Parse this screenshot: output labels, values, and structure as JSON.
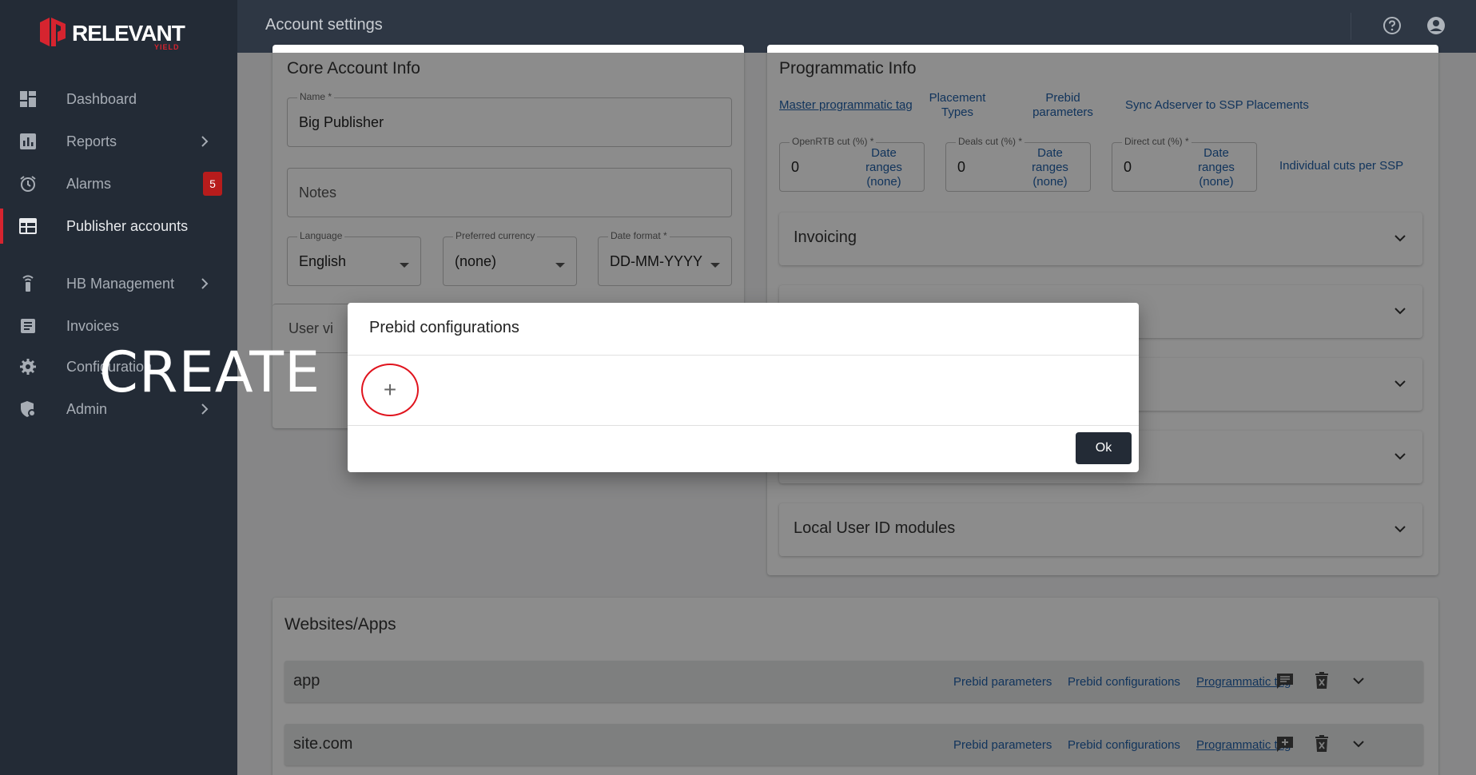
{
  "app": {
    "brand": "RELEVANT",
    "brand_sub": "YIELD",
    "page_title": "Account settings",
    "accent": "#d6242f"
  },
  "sidebar": {
    "items": [
      {
        "label": "Dashboard",
        "icon": "dashboard-icon"
      },
      {
        "label": "Reports",
        "icon": "bar-chart-icon"
      },
      {
        "label": "Alarms",
        "icon": "alarm-clock-icon",
        "badge": "5"
      },
      {
        "label": "Publisher accounts",
        "icon": "table-icon"
      },
      {
        "label": "HB Management",
        "icon": "antenna-icon"
      },
      {
        "label": "Invoices",
        "icon": "document-icon"
      },
      {
        "label": "Configuration",
        "icon": "gear-icon"
      },
      {
        "label": "Admin",
        "icon": "admin-shield-icon"
      }
    ]
  },
  "core": {
    "title": "Core Account Info",
    "name_label": "Name *",
    "name_value": "Big Publisher",
    "notes_placeholder": "Notes",
    "language_label": "Language",
    "language_value": "English",
    "currency_label": "Preferred currency",
    "currency_value": "(none)",
    "date_label": "Date format *",
    "date_value": "DD-MM-YYYY",
    "user_view_label": "User vi"
  },
  "programmatic": {
    "title": "Programmatic Info",
    "links": {
      "master_tag": "Master programmatic tag",
      "placement_types": "Placement Types",
      "prebid_parameters": "Prebid parameters",
      "sync": "Sync Adserver to SSP Placements"
    },
    "cuts": [
      {
        "label": "OpenRTB cut (%) *",
        "value": "0",
        "date_link": "Date ranges (none)"
      },
      {
        "label": "Deals cut (%) *",
        "value": "0",
        "date_link": "Date ranges (none)"
      },
      {
        "label": "Direct cut (%) *",
        "value": "0",
        "date_link": "Date ranges (none)"
      }
    ],
    "individual_cuts": "Individual cuts per SSP",
    "accordions": [
      "Invoicing",
      "",
      "",
      "",
      "Local User ID modules"
    ]
  },
  "websites": {
    "title": "Websites/Apps",
    "rows": [
      {
        "name": "app",
        "prebid_parameters": "Prebid parameters",
        "prebid_configurations": "Prebid configurations",
        "programmatic_tag": "Programmatic tag"
      },
      {
        "name": "site.com",
        "prebid_parameters": "Prebid parameters",
        "prebid_configurations": "Prebid configurations",
        "programmatic_tag": "Programmatic tag"
      }
    ]
  },
  "dialog": {
    "title": "Prebid configurations",
    "add_symbol": "+",
    "ok_label": "Ok"
  },
  "overlay_caption": "CREATE"
}
